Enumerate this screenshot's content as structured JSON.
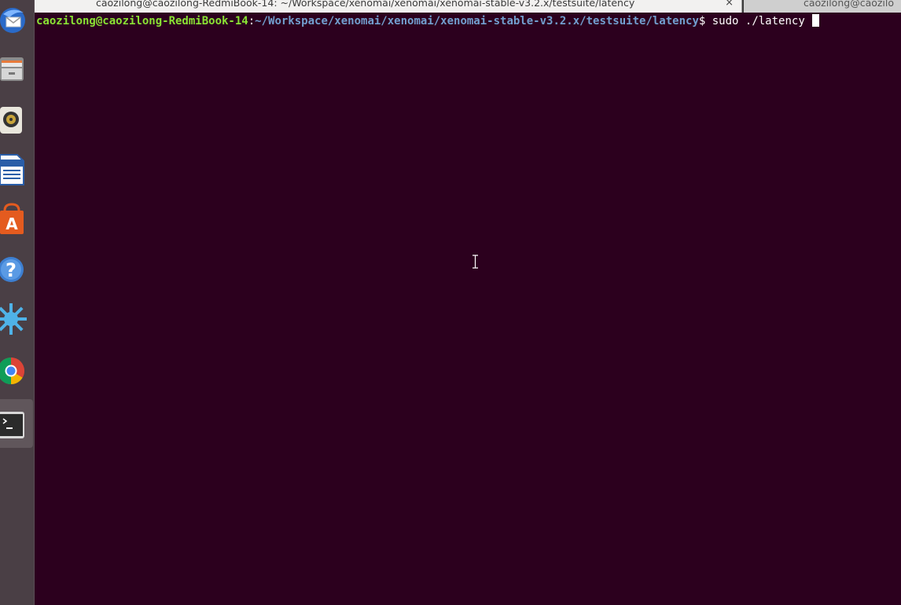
{
  "tabs": [
    {
      "title": "caozilong@caozilong-RedmiBook-14: ~/Workspace/xenomai/xenomai/xenomai-stable-v3.2.x/testsuite/latency",
      "close_glyph": "×",
      "active": true
    },
    {
      "title": "caozilong@caozilo",
      "active": false
    }
  ],
  "terminal": {
    "prompt_user": "caozilong@caozilong-RedmiBook-14",
    "prompt_colon": ":",
    "prompt_path": "~/Workspace/xenomai/xenomai/xenomai-stable-v3.2.x/testsuite/latency",
    "prompt_dollar": "$",
    "command": " sudo ./latency "
  },
  "dock": {
    "items": [
      {
        "icon": "thunderbird-icon"
      },
      {
        "icon": "files-icon"
      },
      {
        "icon": "rhythmbox-icon"
      },
      {
        "icon": "libreoffice-writer-icon"
      },
      {
        "icon": "software-center-icon"
      },
      {
        "icon": "help-icon"
      },
      {
        "icon": "settings-splash-icon"
      },
      {
        "icon": "chrome-icon"
      },
      {
        "icon": "terminal-icon"
      }
    ]
  },
  "colors": {
    "terminal_bg": "#2c001e",
    "prompt_user": "#8ae234",
    "prompt_path": "#729fcf",
    "dock_bg": "#4a3f45"
  }
}
